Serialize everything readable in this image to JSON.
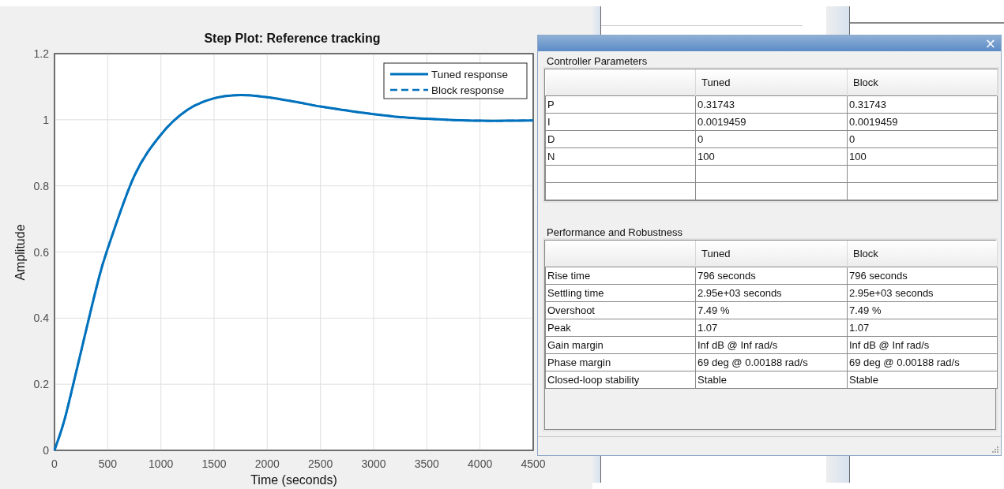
{
  "plot": {
    "chart_data": {
      "type": "line",
      "title": "Step Plot: Reference tracking",
      "xlabel": "Time (seconds)",
      "ylabel": "Amplitude",
      "x": [
        0,
        100,
        250,
        400,
        500,
        750,
        1000,
        1250,
        1500,
        1750,
        2000,
        2250,
        2500,
        2750,
        3000,
        3250,
        3500,
        3750,
        4000,
        4250,
        4500
      ],
      "series": [
        {
          "name": "Tuned response",
          "color": "#0072bd",
          "line_style": "solid",
          "values": [
            0,
            0.1,
            0.3,
            0.5,
            0.61,
            0.83,
            0.955,
            1.03,
            1.065,
            1.075,
            1.068,
            1.055,
            1.04,
            1.028,
            1.017,
            1.008,
            1.003,
            0.999,
            0.997,
            0.997,
            0.998
          ]
        },
        {
          "name": "Block response",
          "color": "#0072bd",
          "line_style": "dashed",
          "values": [
            0,
            0.1,
            0.3,
            0.5,
            0.61,
            0.83,
            0.955,
            1.03,
            1.065,
            1.075,
            1.068,
            1.055,
            1.04,
            1.028,
            1.017,
            1.008,
            1.003,
            0.999,
            0.997,
            0.997,
            0.998
          ]
        }
      ],
      "xlim": [
        0,
        4500
      ],
      "ylim": [
        0,
        1.2
      ],
      "xticks": [
        0,
        500,
        1000,
        1500,
        2000,
        2500,
        3000,
        3500,
        4000,
        4500
      ],
      "yticks": [
        0,
        0.2,
        0.4,
        0.6,
        0.8,
        1,
        1.2
      ],
      "grid": true,
      "legend": true
    }
  },
  "dialog": {
    "close": "×",
    "controller_parameters": {
      "title": "Controller Parameters",
      "columns": [
        "Tuned",
        "Block"
      ],
      "rows": [
        {
          "label": "P",
          "tuned": "0.31743",
          "block": "0.31743"
        },
        {
          "label": "I",
          "tuned": "0.0019459",
          "block": "0.0019459"
        },
        {
          "label": "D",
          "tuned": "0",
          "block": "0"
        },
        {
          "label": "N",
          "tuned": "100",
          "block": "100"
        }
      ]
    },
    "performance": {
      "title": "Performance and Robustness",
      "columns": [
        "Tuned",
        "Block"
      ],
      "rows": [
        {
          "label": "Rise time",
          "tuned": "796 seconds",
          "block": "796 seconds"
        },
        {
          "label": "Settling time",
          "tuned": "2.95e+03 seconds",
          "block": "2.95e+03 seconds"
        },
        {
          "label": "Overshoot",
          "tuned": "7.49 %",
          "block": "7.49 %"
        },
        {
          "label": "Peak",
          "tuned": "1.07",
          "block": "1.07"
        },
        {
          "label": "Gain margin",
          "tuned": "Inf dB @ Inf rad/s",
          "block": "Inf dB @ Inf rad/s"
        },
        {
          "label": "Phase margin",
          "tuned": "69 deg @ 0.00188 rad/s",
          "block": "69 deg @ 0.00188 rad/s"
        },
        {
          "label": "Closed-loop stability",
          "tuned": "Stable",
          "block": "Stable"
        }
      ]
    }
  }
}
